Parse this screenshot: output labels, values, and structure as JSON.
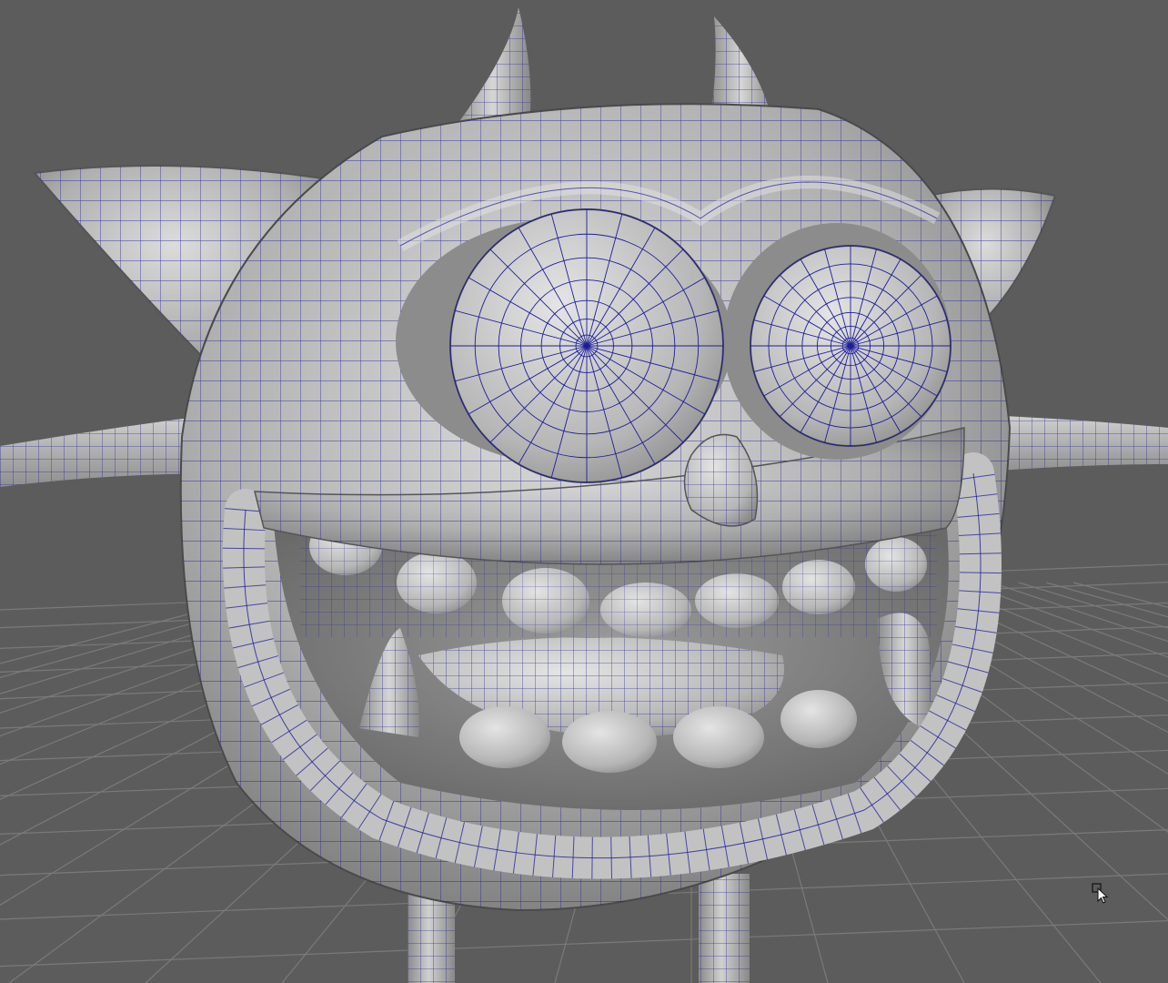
{
  "viewport": {
    "background_color": "#5c5c5c",
    "grid_line_color": "#7a7a7a",
    "grid_line_color_major": "#8a8a8a",
    "wireframe_color": "#1e1e9a",
    "mesh_base_color": "#b4b4b4",
    "mesh_highlight_color": "#e6e6e6",
    "mesh_shadow_color": "#6a6a6a"
  },
  "model": {
    "parts": [
      "left-horn",
      "right-horn",
      "left-ear",
      "right-ear",
      "head",
      "left-eye",
      "right-eye",
      "nose",
      "upper-teeth",
      "left-fang",
      "right-fang",
      "tongue",
      "lower-teeth",
      "mouth-rim",
      "left-arm",
      "right-arm",
      "left-leg",
      "right-leg"
    ]
  },
  "cursor": {
    "icon": "select-cursor-icon"
  }
}
